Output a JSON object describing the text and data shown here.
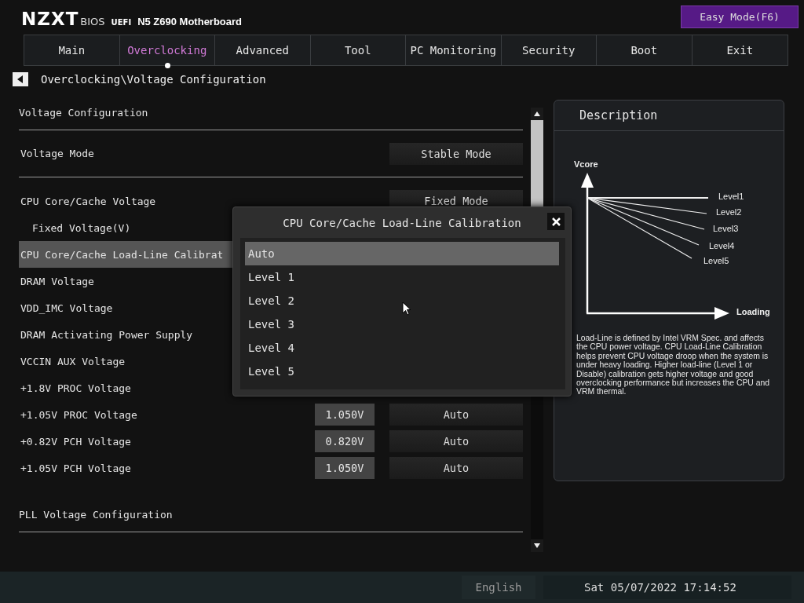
{
  "header": {
    "brand": "NZXT",
    "product": "BIOS",
    "firmware": "UEFI",
    "model": "N5 Z690 Motherboard",
    "mode_button": "Easy Mode(F6)"
  },
  "tabs": [
    {
      "label": "Main",
      "selected": false
    },
    {
      "label": "Overclocking",
      "selected": true
    },
    {
      "label": "Advanced",
      "selected": false
    },
    {
      "label": "Tool",
      "selected": false
    },
    {
      "label": "PC Monitoring",
      "selected": false
    },
    {
      "label": "Security",
      "selected": false
    },
    {
      "label": "Boot",
      "selected": false
    },
    {
      "label": "Exit",
      "selected": false
    }
  ],
  "breadcrumb": "Overclocking\\Voltage Configuration",
  "settings": [
    {
      "kind": "heading",
      "label": "Voltage Configuration",
      "selected": false
    },
    {
      "kind": "block",
      "label": "Voltage Mode",
      "option": "Stable Mode",
      "selected": false
    },
    {
      "kind": "item",
      "label": "CPU Core/Cache Voltage",
      "option": "Fixed Mode",
      "selected": false,
      "children": [
        {
          "kind": "item",
          "label": "Fixed Voltage(V)",
          "selected": false
        }
      ]
    },
    {
      "kind": "item",
      "label": "CPU Core/Cache Load-Line Calibrat",
      "selected": true
    },
    {
      "kind": "item",
      "label": "DRAM Voltage",
      "selected": false
    },
    {
      "kind": "item",
      "label": "VDD_IMC Voltage",
      "selected": false
    },
    {
      "kind": "item",
      "label": "DRAM Activating Power Supply",
      "selected": false
    },
    {
      "kind": "item",
      "label": "VCCIN AUX Voltage",
      "selected": false
    },
    {
      "kind": "item",
      "label": "+1.8V PROC Voltage",
      "selected": false
    },
    {
      "kind": "item",
      "label": "+1.05V PROC Voltage",
      "reading": "1.050V",
      "option": "Auto",
      "selected": false
    },
    {
      "kind": "item",
      "label": "+0.82V PCH Voltage",
      "reading": "0.820V",
      "option": "Auto",
      "selected": false
    },
    {
      "kind": "item",
      "label": "+1.05V PCH Voltage",
      "reading": "1.050V",
      "option": "Auto",
      "selected": false
    },
    {
      "kind": "heading",
      "label": "PLL Voltage Configuration",
      "selected": false
    }
  ],
  "description": {
    "title": "Description",
    "y_axis": "Vcore",
    "x_axis": "Loading",
    "curves": [
      "Level1",
      "Level2",
      "Level3",
      "Level4",
      "Level5"
    ],
    "text": "Load-Line is defined by Intel VRM Spec. and affects the CPU power voltage. CPU Load-Line Calibration helps prevent CPU voltage droop when the system is under heavy loading. Higher load-line (Level 1 or Disable) calibration gets higher voltage and good overclocking performance but increases the CPU and VRM thermal."
  },
  "dialog": {
    "title": "CPU Core/Cache Load-Line Calibration",
    "options": [
      {
        "label": "Auto",
        "selected": true
      },
      {
        "label": "Level 1",
        "selected": false
      },
      {
        "label": "Level 2",
        "selected": false
      },
      {
        "label": "Level 3",
        "selected": false
      },
      {
        "label": "Level 4",
        "selected": false
      },
      {
        "label": "Level 5",
        "selected": false
      }
    ]
  },
  "status_bar": {
    "language": "English",
    "datetime": "Sat 05/07/2022 17:14:52"
  }
}
